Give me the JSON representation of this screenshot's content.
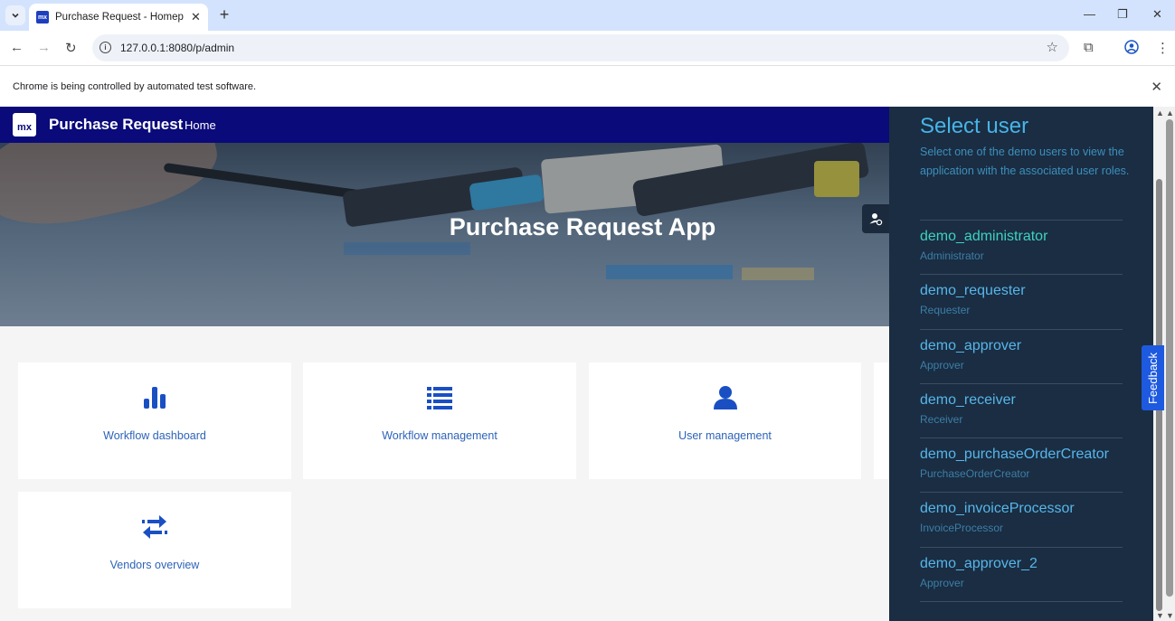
{
  "browser": {
    "tab_title": "Purchase Request - Homepage",
    "favicon_text": "mx",
    "url": "127.0.0.1:8080/p/admin",
    "infobar_text": "Chrome is being controlled by automated test software."
  },
  "app": {
    "logo_text": "mx",
    "title": "Purchase Request",
    "nav_home": "Home",
    "hero_title": "Purchase Request App"
  },
  "cards": [
    {
      "label": "Workflow dashboard",
      "icon": "bar-chart-icon"
    },
    {
      "label": "Workflow management",
      "icon": "list-icon"
    },
    {
      "label": "User management",
      "icon": "user-icon"
    },
    {
      "label": "Vendors overview",
      "icon": "exchange-arrows-icon"
    }
  ],
  "panel": {
    "title": "Select user",
    "description": "Select one of the demo users to view the application with the associated user roles.",
    "users": [
      {
        "name": "demo_administrator",
        "role": "Administrator"
      },
      {
        "name": "demo_requester",
        "role": "Requester"
      },
      {
        "name": "demo_approver",
        "role": "Approver"
      },
      {
        "name": "demo_receiver",
        "role": "Receiver"
      },
      {
        "name": "demo_purchaseOrderCreator",
        "role": "PurchaseOrderCreator"
      },
      {
        "name": "demo_invoiceProcessor",
        "role": "InvoiceProcessor"
      },
      {
        "name": "demo_approver_2",
        "role": "Approver"
      }
    ]
  },
  "feedback_label": "Feedback",
  "colors": {
    "header": "#0a0a7a",
    "panel": "#1a2d42",
    "accent_link": "#2d63b8",
    "active_user": "#3fd1c0"
  }
}
